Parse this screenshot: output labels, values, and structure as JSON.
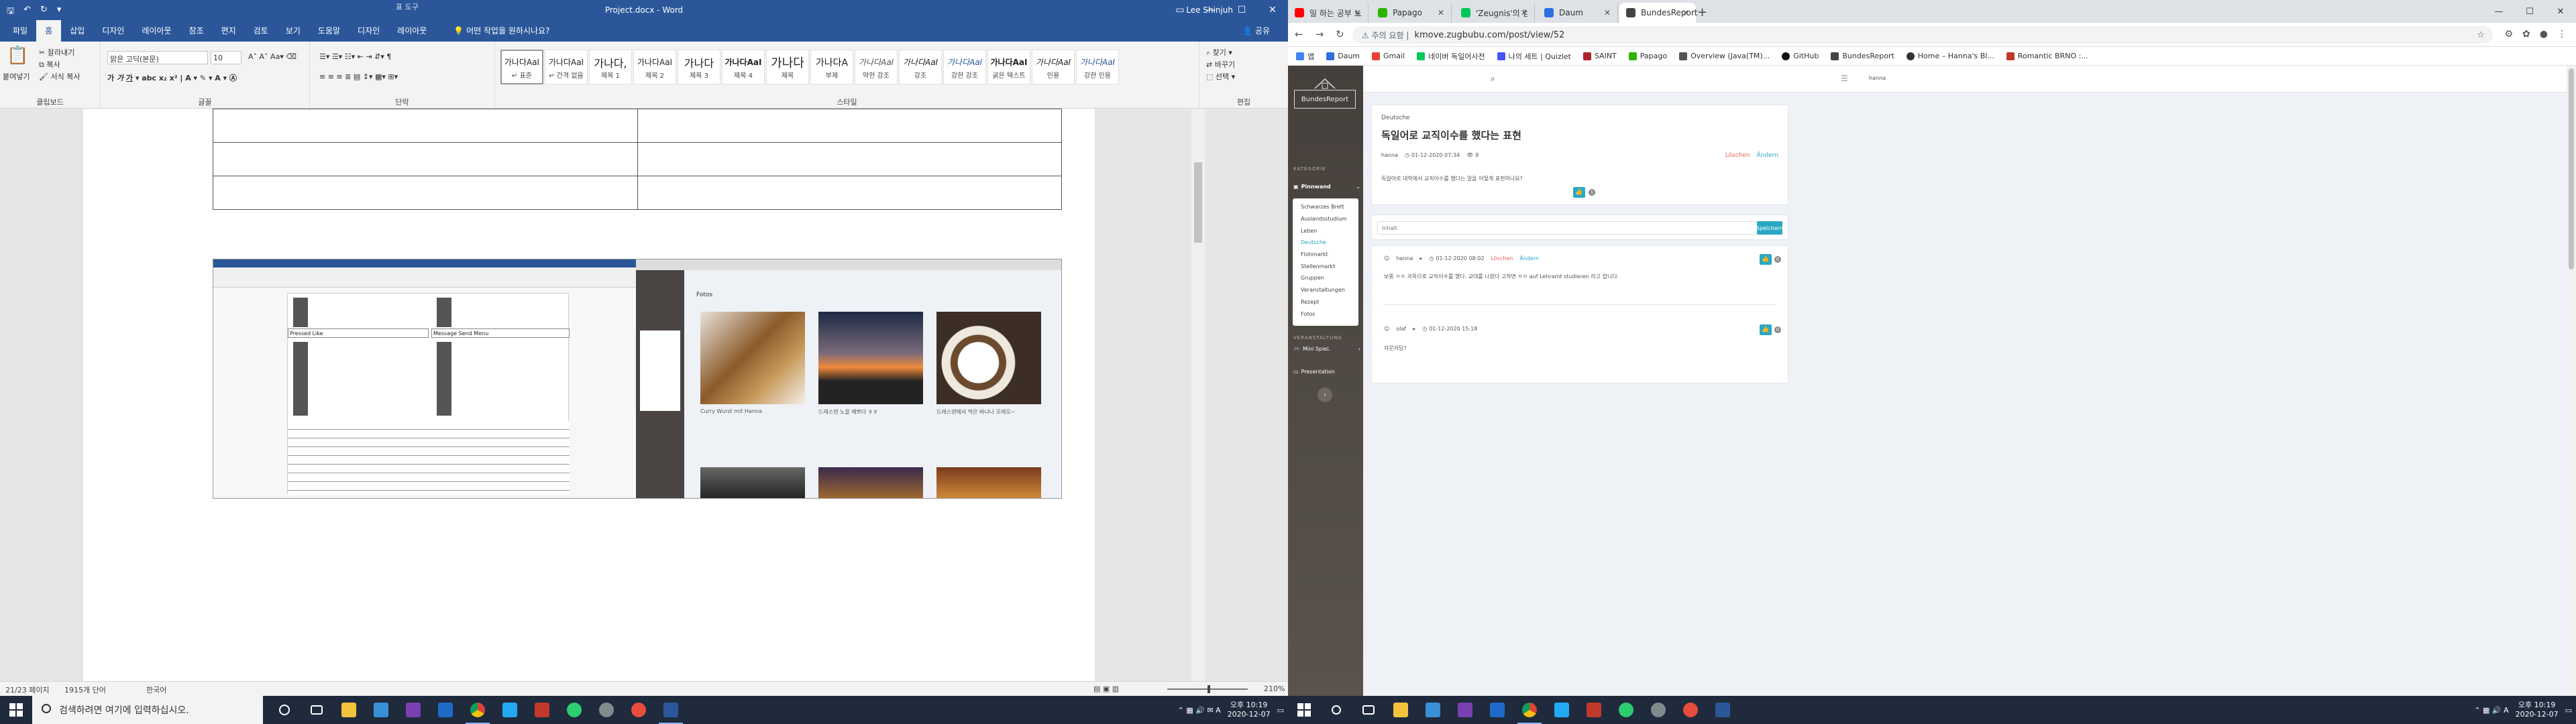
{
  "word": {
    "context_label": "표 도구",
    "doc_title": "Project.docx - Word",
    "user": "Lee Shinjuh",
    "tabs": [
      "파일",
      "홈",
      "삽입",
      "디자인",
      "레이아웃",
      "참조",
      "편지",
      "검토",
      "보기",
      "도움말",
      "디자인",
      "레이아웃"
    ],
    "active_tab_index": 1,
    "tell_me": "어떤 작업을 원하시나요?",
    "share": "공유",
    "clipboard": {
      "paste": "붙여넣기",
      "cut": "잘라내기",
      "copy": "복사",
      "format_painter": "서식 복사",
      "label": "클립보드"
    },
    "font": {
      "name": "맑은 고딕(본문)",
      "size": "10",
      "label": "글꼴"
    },
    "paragraph_label": "단락",
    "styles_label": "스타일",
    "styles": [
      {
        "sample": "가나다AaI",
        "name": "↵ 표준"
      },
      {
        "sample": "가나다AaI",
        "name": "↵ 간격 없음"
      },
      {
        "sample": "가나다,",
        "name": "제목 1"
      },
      {
        "sample": "가나다AaI",
        "name": "제목 2"
      },
      {
        "sample": "가나다",
        "name": "제목 3"
      },
      {
        "sample": "가나다AaI",
        "name": "제목 4"
      },
      {
        "sample": "가나다",
        "name": "제목"
      },
      {
        "sample": "가나다A",
        "name": "부제"
      },
      {
        "sample": "가나다AaI",
        "name": "약한 강조"
      },
      {
        "sample": "가나다AaI",
        "name": "강조"
      },
      {
        "sample": "가나다AaI",
        "name": "강한 강조"
      },
      {
        "sample": "가나다AaI",
        "name": "굵은 텍스트"
      },
      {
        "sample": "가나다AaI",
        "name": "인용"
      },
      {
        "sample": "가나다AaI",
        "name": "강한 인용"
      }
    ],
    "editing": {
      "find": "찾기",
      "replace": "바꾸기",
      "select": "선택",
      "label": "편집"
    },
    "embedded": {
      "cell_a": "Pressed Like",
      "cell_b": "Message Send Menu",
      "photos_title": "Fotos",
      "captions": [
        "Curry Wurst mit Hanna",
        "드레스덴 노을 예쁘다 ㅎㅎ",
        "드레스덴에서 먹은 바나나 오레오~"
      ]
    },
    "status": {
      "page": "21/23 페이지",
      "words": "1915개 단어",
      "lang": "한국어",
      "zoom": "210%"
    }
  },
  "taskbar_left": {
    "search_placeholder": "검색하려면 여기에 입력하십시오.",
    "time": "오후 10:19",
    "date": "2020-12-07"
  },
  "taskbar_right": {
    "time": "오후 10:19",
    "date": "2020-12-07"
  },
  "chrome": {
    "tabs": [
      {
        "title": "일 하는 공부 노래 모음",
        "color": "#ff0000"
      },
      {
        "title": "Papago",
        "color": "#2db400"
      },
      {
        "title": "'Zeugnis'의 검색결과 : 네이버",
        "color": "#03c75a"
      },
      {
        "title": "Daum",
        "color": "#2f6fe0"
      },
      {
        "title": "BundesReport",
        "color": "#444444"
      }
    ],
    "active_tab_index": 4,
    "url_warning": "주의 요함",
    "url": "kmove.zugbubu.com/post/view/52",
    "bookmarks": [
      "앱",
      "Daum",
      "Gmail",
      "네이버 독일어사전",
      "나의 세트 | Quizlet",
      "SAINT",
      "Papago",
      "Overview (Java(TM)...",
      "GitHub",
      "BundesReport",
      "Home – Hanna's Bl...",
      "Romantic BRNO :..."
    ]
  },
  "site": {
    "brand": "BundesReport",
    "category_heading": "KATEGORIE",
    "pinnwand": "Pinnwand",
    "menu": [
      "Schwarzes Brett",
      "Auslandsstudium",
      "Leben",
      "Deutsche",
      "Flohmarkt",
      "Stellenmarkt",
      "Gruppen",
      "Veranstaltungen",
      "Rezept",
      "Fotos"
    ],
    "active_menu_index": 3,
    "veranstaltung_heading": "VERANSTALTUNG",
    "mini_spiel": "Mini Spiel.",
    "presentation": "Presentation",
    "user": "hanna",
    "post": {
      "category": "Deutsche",
      "title": "독일어로 교직이수를 했다는 표현",
      "author": "hanna",
      "date": "01-12-2020 07:34",
      "views": "8",
      "delete": "Löschen",
      "edit": "Ändern",
      "body": "독일어로 대학에서 교직이수를 했다는 말을 어떻게 표현하나요?",
      "likes": "1"
    },
    "comment_form": {
      "placeholder": "Inhalt",
      "button": "Speichern"
    },
    "comments": [
      {
        "author": "hanna",
        "date": "01-12-2020 08:02",
        "delete": "Löschen",
        "edit": "Ändern",
        "text": "보통 ㅇㅇ 과목으로 교직이수를 했다. 교대를 나왔다 고하면 ㅇㅇ auf Lehramt studieren 라고 합니다.",
        "likes": "0"
      },
      {
        "author": "olaf",
        "date": "01-12-2020 15:18",
        "text": "자문자답?",
        "likes": "0"
      }
    ]
  },
  "colors": {
    "word_blue": "#2b579a",
    "accent": "#2aa8c4",
    "danger": "#e2625f",
    "sidebar": "#4a4542",
    "taskbar": "#1f2a3c"
  }
}
